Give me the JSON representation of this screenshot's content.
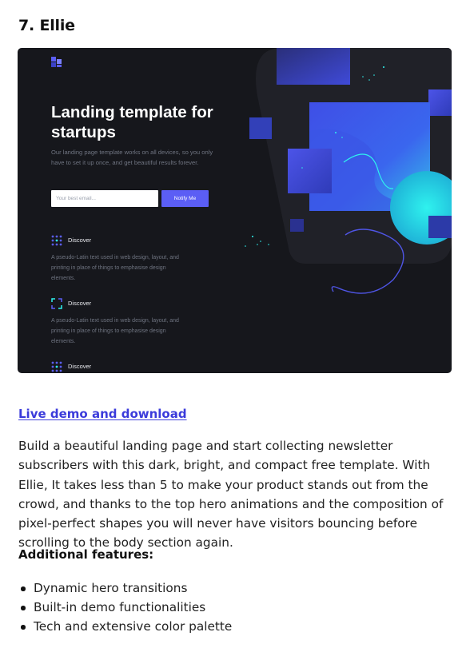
{
  "article": {
    "heading": "7. Ellie",
    "link_text": "Live demo and download",
    "description": "Build a beautiful landing page and start collecting newsletter subscribers with this dark, bright, and compact free template. With Ellie, It takes less than 5 to make your product stands out from the crowd, and thanks to the top hero animations and the composition of pixel-perfect shapes you will never have visitors bouncing before scrolling to the body section again.",
    "features_heading": "Additional features:",
    "features": [
      "Dynamic hero transitions",
      "Built-in demo functionalities",
      "Tech and extensive color palette"
    ]
  },
  "preview": {
    "hero_title": "Landing template for startups",
    "hero_subtitle": "Our landing page template works on all devices, so you only have to set it up once, and get beautiful results forever.",
    "email_placeholder": "Your best email...",
    "notify_label": "Notify Me",
    "features": [
      {
        "title": "Discover",
        "text": "A pseudo-Latin text used in web design, layout, and printing in place of things to emphasise design elements.",
        "icon": "grid-dots-icon"
      },
      {
        "title": "Discover",
        "text": "A pseudo-Latin text used in web design, layout, and printing in place of things to emphasise design elements.",
        "icon": "frame-corners-icon"
      },
      {
        "title": "Discover",
        "text": "",
        "icon": "grid-dots-icon"
      }
    ]
  },
  "colors": {
    "link": "#3b3bdb",
    "preview_bg": "#16171c",
    "accent": "#5b5ef5"
  }
}
